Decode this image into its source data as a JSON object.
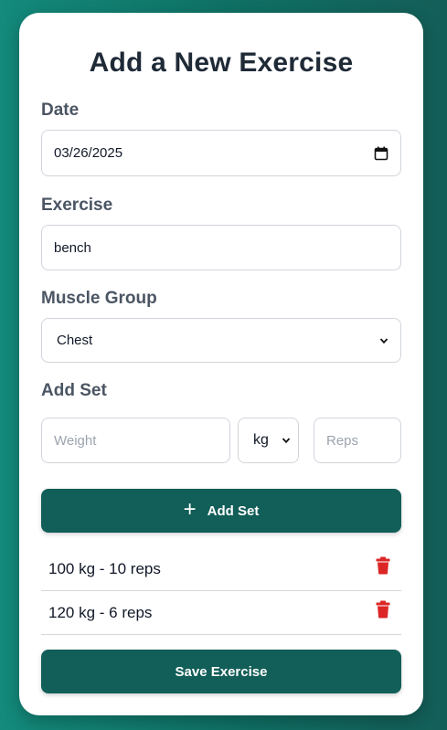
{
  "form": {
    "title": "Add a New Exercise",
    "date_label": "Date",
    "date_value": "03/26/2025",
    "exercise_label": "Exercise",
    "exercise_value": "bench",
    "muscle_group_label": "Muscle Group",
    "muscle_group_value": "Chest",
    "add_set_label": "Add Set",
    "weight_placeholder": "Weight",
    "unit_value": "kg",
    "reps_placeholder": "Reps",
    "add_set_button": "Add Set",
    "save_button": "Save Exercise"
  },
  "sets": [
    {
      "text": "100 kg - 10 reps"
    },
    {
      "text": "120 kg - 6 reps"
    }
  ],
  "icons": {
    "calendar": "calendar-icon",
    "dropdown": "chevron-down-icon",
    "plus": "plus-icon",
    "trash": "trash-icon"
  },
  "colors": {
    "accent": "#125e58",
    "delete": "#dc2626",
    "background_start": "#138a7c",
    "background_end": "#145e58"
  }
}
